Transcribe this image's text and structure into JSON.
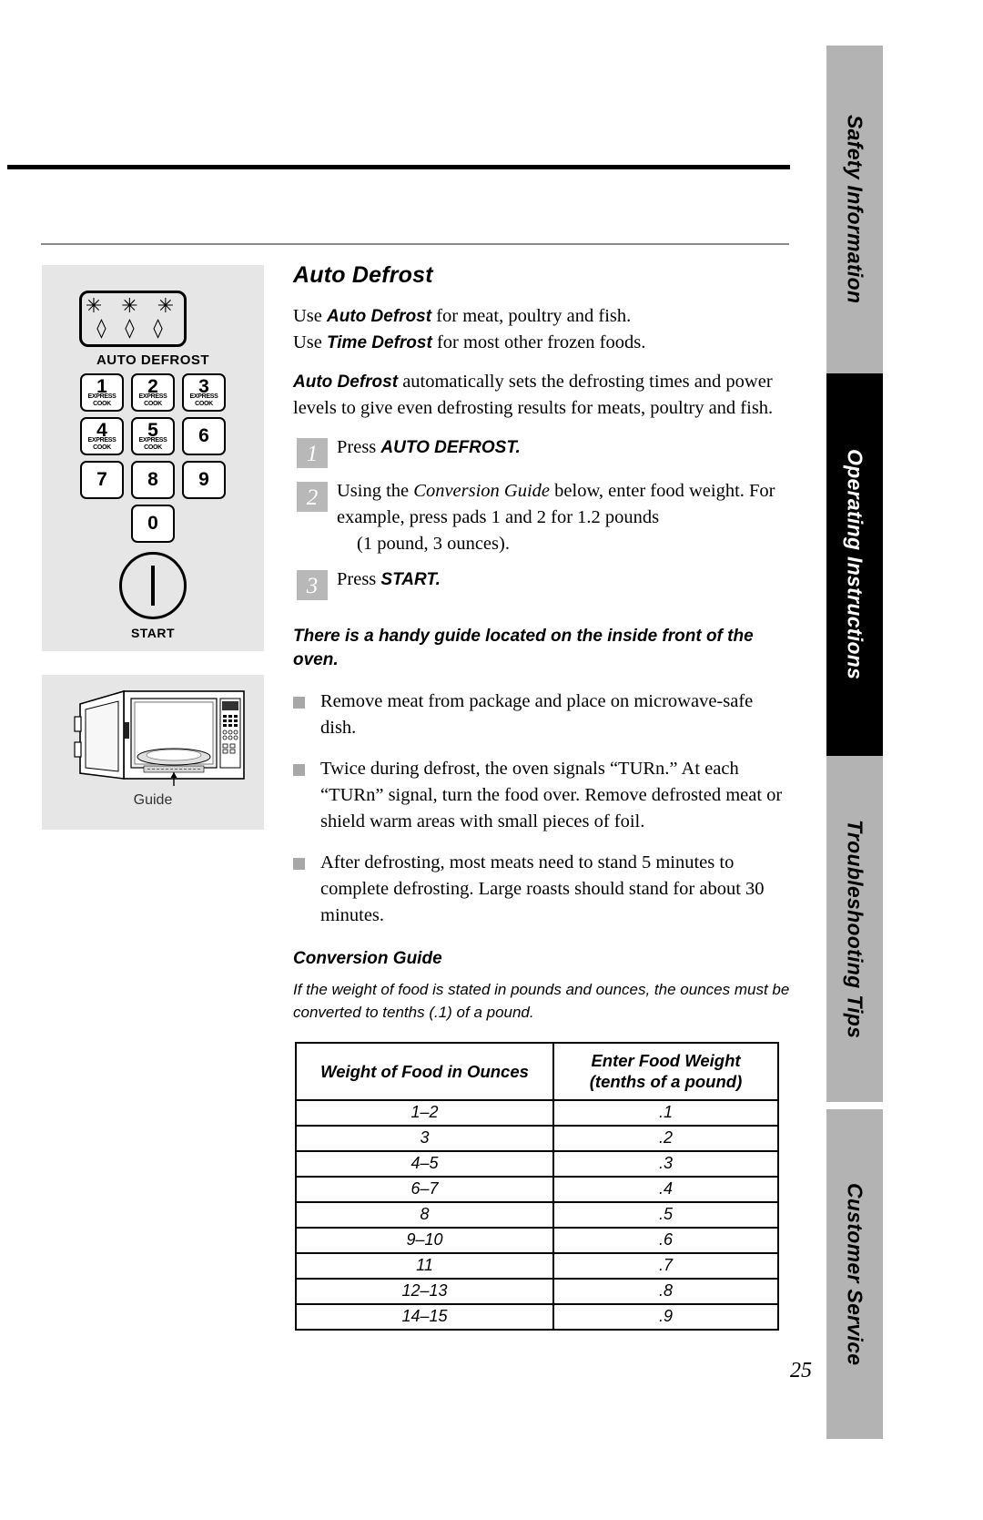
{
  "side_tabs": [
    {
      "label": "Safety Information"
    },
    {
      "label": "Operating Instructions"
    },
    {
      "label": "Troubleshooting Tips"
    },
    {
      "label": "Customer Service"
    }
  ],
  "control_panel": {
    "display_snow": "✳ ✳ ✳",
    "display_drops": "◊ ◊ ◊",
    "auto_defrost_label": "AUTO DEFROST",
    "start_label": "START",
    "keys": [
      {
        "num": "1",
        "sub": "EXPRESS COOK"
      },
      {
        "num": "2",
        "sub": "EXPRESS COOK"
      },
      {
        "num": "3",
        "sub": "EXPRESS COOK"
      },
      {
        "num": "4",
        "sub": "EXPRESS COOK"
      },
      {
        "num": "5",
        "sub": "EXPRESS COOK"
      },
      {
        "num": "6",
        "sub": ""
      },
      {
        "num": "7",
        "sub": ""
      },
      {
        "num": "8",
        "sub": ""
      },
      {
        "num": "9",
        "sub": ""
      },
      {
        "num": "0",
        "sub": ""
      }
    ]
  },
  "oven_figure": {
    "caption": "Guide"
  },
  "content": {
    "title": "Auto Defrost",
    "intro_line1_pre": "Use ",
    "intro_line1_bold": "Auto Defrost",
    "intro_line1_post": " for meat, poultry and fish.",
    "intro_line2_pre": "Use ",
    "intro_line2_bold": "Time Defrost",
    "intro_line2_post": " for most other frozen foods.",
    "para2_bold": "Auto Defrost",
    "para2_rest": " automatically sets the defrosting times and power levels to give even defrosting results for meats, poultry and fish.",
    "steps": [
      {
        "num": "1",
        "text_pre": "Press ",
        "text_bold": "AUTO DEFROST.",
        "text_post": "",
        "extra": ""
      },
      {
        "num": "2",
        "text_pre": "Using the ",
        "text_bold": "Conversion Guide",
        "text_post": " below, enter food weight. For example, press pads 1 and 2 for 1.2 pounds",
        "extra": "(1 pound, 3 ounces)."
      },
      {
        "num": "3",
        "text_pre": "Press ",
        "text_bold": "START.",
        "text_post": "",
        "extra": ""
      }
    ],
    "handy_note": "There is a handy guide located on the inside front of the oven.",
    "bullets": [
      "Remove meat from package and place on microwave-safe dish.",
      "Twice during defrost, the oven signals “TURn.” At each “TURn” signal, turn the food over. Remove defrosted meat or shield warm areas with small pieces of foil.",
      "After defrosting, most meats need to stand 5 minutes to complete defrosting. Large roasts should stand for about 30 minutes."
    ],
    "conversion_title": "Conversion Guide",
    "conversion_note": "If the weight of food is stated in pounds and ounces, the ounces must be converted to tenths (.1) of a pound.",
    "table": {
      "headers": [
        "Weight of Food in Ounces",
        "Enter Food Weight\n(tenths of a pound)"
      ],
      "header_col2_line1": "Enter Food Weight",
      "header_col2_line2": "(tenths of a pound)",
      "rows": [
        [
          "1–2",
          ".1"
        ],
        [
          "3",
          ".2"
        ],
        [
          "4–5",
          ".3"
        ],
        [
          "6–7",
          ".4"
        ],
        [
          "8",
          ".5"
        ],
        [
          "9–10",
          ".6"
        ],
        [
          "11",
          ".7"
        ],
        [
          "12–13",
          ".8"
        ],
        [
          "14–15",
          ".9"
        ]
      ]
    }
  },
  "page_number": "25"
}
